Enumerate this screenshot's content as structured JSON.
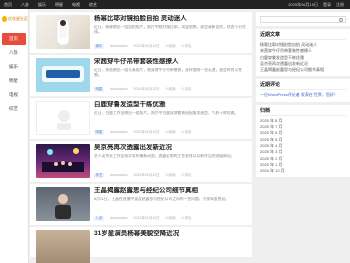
{
  "topbar": {
    "nav": [
      "首页",
      "八卦",
      "娱乐",
      "明星",
      "电视",
      "综艺"
    ],
    "date": "2025年06月15日",
    "actions": [
      "登录",
      "注册"
    ]
  },
  "sidebar": {
    "logo_text": "优花星社区",
    "items": [
      "首页",
      "八卦",
      "娱乐",
      "明星",
      "电视",
      "综艺"
    ]
  },
  "posts": [
    {
      "title": "杨幂比耶对镜拍脸自拍 灵动迷人",
      "excerpt": "近日，杨幂晒出一组自拍照片，照片中她对镜比耶，笑容甜美，造型清新自然，状态十分在线。",
      "tag": "娱乐",
      "author": "doudouduo",
      "date": "2024年01月12日",
      "reads": "0 阅读",
      "likes": "0 评论"
    },
    {
      "title": "宋茜穿牛仔吊带套装性感撩人",
      "excerpt": "近日，宋茜晒出一组写真照片，她身穿牛仔吊带套装，身材曲线一览无遗，造型时尚又性感。",
      "tag": "明星",
      "author": "doudouduo",
      "date": "2024年01月12日",
      "reads": "0 阅读",
      "likes": "0 评论"
    },
    {
      "title": "白鹿穿鲁发造型干练优雅",
      "excerpt": "近日，白鹿工作室晒出一组照片，照片中白鹿身穿套装搭配鲁发造型，气质干练优雅。",
      "tag": "明星",
      "author": "doudouduo",
      "date": "2024年01月12日",
      "reads": "0 阅读",
      "likes": "0 评论"
    },
    {
      "title": "吴京亮再次透露出发新近况",
      "excerpt": "艺人吴京亮工作室再次发布最新动态，透露近期的工作安排以及新作品的进展情况。",
      "tag": "综艺",
      "author": "doudouduo",
      "date": "2024年01月12日",
      "reads": "0 阅读",
      "likes": "0 评论"
    },
    {
      "title": "王晶揭露赵露思与经纪公司细节真相",
      "excerpt": "6月11日，王晶在直播中谈及赵露思与经纪公司之间的一些问题，引发网友热议。",
      "tag": "八卦",
      "author": "doudouduo",
      "date": "2024年01月12日",
      "reads": "0 阅读",
      "likes": "0 评论"
    },
    {
      "title": "31岁星演员杨幂美貌空降近况",
      "excerpt": "",
      "tag": "",
      "author": "",
      "date": "",
      "reads": "",
      "likes": ""
    }
  ],
  "right": {
    "search_title": "",
    "recent_title": "近期文章",
    "recent": [
      "杨幂比耶对镜拍脸自拍 灵动迷人",
      "宋茜穿牛仔吊带套装性感撩人",
      "白鹿穿鲁发造型干练优雅",
      "吴京亮再次透露出发新近况",
      "王晶揭露赵露思与经纪公司细节真相"
    ],
    "comments_title": "近期评论",
    "comments": [
      "一位WordPress评论者 发表在 世界，您好！"
    ],
    "archive_title": "归档",
    "archive": [
      "2025 年 8 月",
      "2025 年 7 月",
      "2025 年 6 月",
      "2025 年 5 月",
      "2025 年 4 月",
      "2025 年 3 月",
      "2025 年 2 月",
      "2025 年 1 月",
      "2024 年 12 月"
    ]
  },
  "colors": {
    "accent": "#e74c3c",
    "topbar": "#222222",
    "link": "#3a63c7"
  }
}
